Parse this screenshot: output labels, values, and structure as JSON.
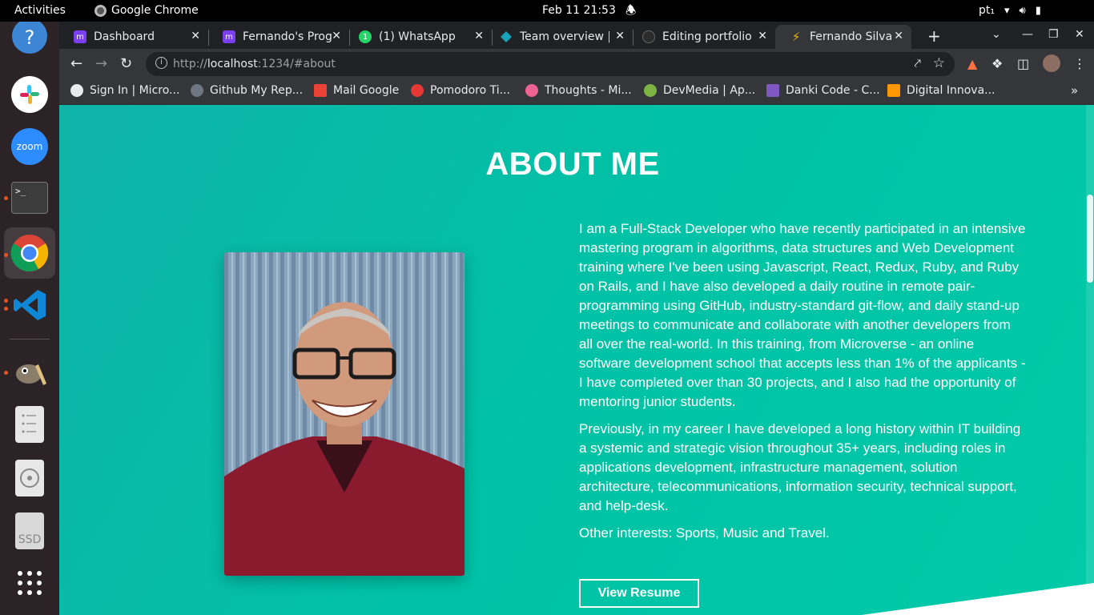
{
  "system": {
    "activities": "Activities",
    "app_name": "Google Chrome",
    "clock": "Feb 11  21:53",
    "keyboard_layout": "pt₁"
  },
  "dock": {
    "items": [
      "help-icon",
      "slack-icon",
      "zoom-icon",
      "terminal-icon",
      "chrome-icon",
      "vscode-icon",
      "gimp-icon",
      "files-icon",
      "disk-icon",
      "ssd-icon",
      "show-apps-icon"
    ],
    "zoom_label": "zoom",
    "ssd_label": "SSD",
    "terminal_label": ">_"
  },
  "tabs": [
    {
      "title": "Dashboard",
      "color": "#7b3ff2"
    },
    {
      "title": "Fernando's Prog",
      "color": "#7b3ff2"
    },
    {
      "title": "(1) WhatsApp",
      "color": "#25d366"
    },
    {
      "title": "Team overview |",
      "color": "#17a2b8"
    },
    {
      "title": "Editing portfolio",
      "color": "#333333"
    },
    {
      "title": "Fernando Silva |",
      "color": "#f2b705"
    }
  ],
  "toolbar": {
    "url_scheme": "http://",
    "url_host": "localhost",
    "url_rest": ":1234/#about"
  },
  "bookmarks": [
    {
      "title": "Sign In | Micro...",
      "color": "#e8eaed"
    },
    {
      "title": "Github My Rep...",
      "color": "#6e7681"
    },
    {
      "title": "Mail Google",
      "color": "#ea4335"
    },
    {
      "title": "Pomodoro Ti...",
      "color": "#e53935"
    },
    {
      "title": "Thoughts - Mi...",
      "color": "#f06292"
    },
    {
      "title": "DevMedia | Ap...",
      "color": "#7cb342"
    },
    {
      "title": "Danki Code - C...",
      "color": "#7e57c2"
    },
    {
      "title": "Digital Innova...",
      "color": "#ff9800"
    }
  ],
  "page": {
    "title": "ABOUT ME",
    "bio_p1": "I am a Full-Stack Developer who have recently participated in an intensive mastering program in algorithms, data structures and Web Development training where I've been using Javascript, React, Redux, Ruby, and Ruby on Rails, and I have also developed a daily routine in remote pair-programming using GitHub, industry-standard git-flow, and daily stand-up meetings to communicate and collaborate with another developers from all over the real-world. In this training, from Microverse - an online software development school that accepts less than 1% of the applicants - I have completed over than 30 projects, and I also had the opportunity of mentoring junior students.",
    "bio_p2": "Previously, in my career I have developed a long history within IT building a systemic and strategic vision throughout 35+ years, including roles in applications development, infrastructure management, solution architecture, telecommunications, information security, technical support, and help-desk.",
    "bio_p3": "Other interests: Sports, Music and Travel.",
    "resume_label": "View Resume"
  }
}
